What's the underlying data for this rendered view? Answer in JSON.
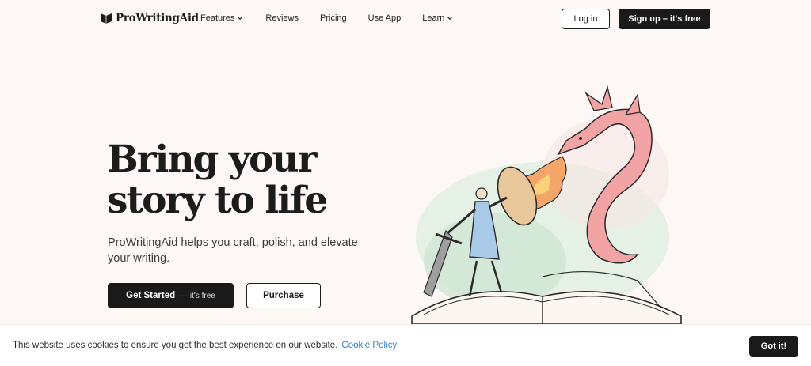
{
  "nav": {
    "logo_text": "ProWritingAid",
    "logo_icon": "book-heart-logo-icon",
    "links": [
      {
        "label": "Features",
        "has_dropdown": true
      },
      {
        "label": "Reviews",
        "has_dropdown": false
      },
      {
        "label": "Pricing",
        "has_dropdown": false
      },
      {
        "label": "Use App",
        "has_dropdown": false
      },
      {
        "label": "Learn",
        "has_dropdown": true
      }
    ],
    "login_label": "Log in",
    "signup_label": "Sign up – it's free"
  },
  "hero": {
    "title_line1": "Bring your",
    "title_line2": "story to life",
    "subtitle": "ProWritingAid helps you craft, polish, and elevate your writing.",
    "primary_cta": "Get Started",
    "primary_cta_extra": "— it's free",
    "secondary_cta": "Purchase",
    "illustration": "knight-fighting-dragon-from-open-book"
  },
  "cookie": {
    "text": "This website uses cookies to ensure you get the best experience on our website.",
    "link_label": "Cookie Policy",
    "accept_label": "Got it!"
  },
  "colors": {
    "background": "#fdf8f5",
    "primary_dark": "#1a1a1a",
    "link": "#2f7ecb",
    "dragon_pink": "#f2a4a4",
    "knight_blue": "#a9c9e8"
  }
}
